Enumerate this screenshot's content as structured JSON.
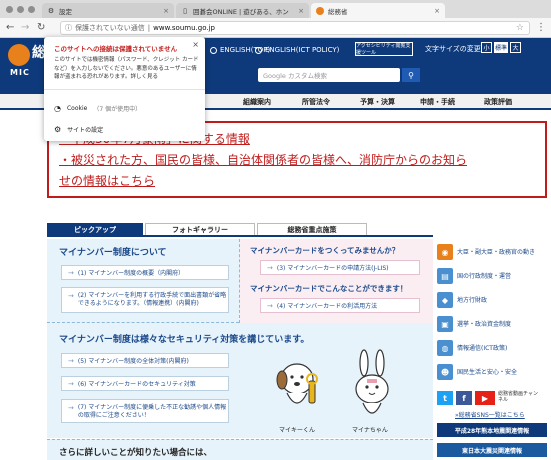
{
  "browser": {
    "tabs": [
      {
        "label": "設定",
        "icon": "gear-icon"
      },
      {
        "label": "囲碁会ONLINE | 遊びある、ホン",
        "icon": "document-icon"
      },
      {
        "label": "総務省",
        "icon": "soumu-favicon"
      }
    ],
    "security_label": "保護されていない通信",
    "url": "www.soumu.go.jp"
  },
  "popup": {
    "title": "このサイトへの接続は保護されていません",
    "body": "このサイトでは機密情報（パスワード、クレジット カードなど）を入力しないでください。悪意のあるユーザーに情報が盗まれる恐れがあります。詳しく見る",
    "cookie_label": "Cookie",
    "cookie_sub": "（7 個が使用中）",
    "settings_label": "サイトの設定"
  },
  "header": {
    "logo_text": "総",
    "logo_mic": "MIC",
    "english_top": "ENGLISH(TOP)",
    "english_ict": "ENGLISH(ICT POLICY)",
    "access_tool": "アクセシビリティ閲覧支援ツール",
    "fontsize_label": "文字サイズの変更",
    "fontsize_small": "小",
    "fontsize_standard": "標準",
    "fontsize_large": "大",
    "search_placeholder": "Google カスタム検索"
  },
  "gnav": [
    "組織案内",
    "所管法令",
    "予算・決算",
    "申請・手続",
    "政策評価"
  ],
  "alert": {
    "line1": "「平成30年7月豪雨」に関する情報",
    "line2": "・被災された方、国民の皆様、自治体関係者の皆様へ、消防庁からのお知ら",
    "line3": "せの情報はこちら"
  },
  "content_tabs": [
    "ピックアップ",
    "フォトギャラリー",
    "総務省重点施策"
  ],
  "mynumber": {
    "heading_about": "マイナンバー制度について",
    "links_blue": [
      "(1) マイナンバー制度の概要（内閣府）",
      "(2) マイナンバーを利用する行政手続で面出書類が省略できるようになります。（情報連携）(内閣府)"
    ],
    "card_question": "マイナンバーカードをつくってみませんか？",
    "link_card_apply": "(3) マイナンバーカードの申請方法(J-LIS)",
    "card_heading2": "マイナンバーカードでこんなことができます！",
    "link_card_usage": "(4) マイナンバーカードの利活用方法",
    "security_heading": "マイナンバー制度は様々なセキュリティ対策を講じています。",
    "security_links": [
      "(5) マイナンバー制度の全体対策(内閣府)",
      "(6) マイナンバーカードのセキュリティ対策",
      "(7) マイナンバー制度に便乗した不正な勧誘や個人情報の取得にご注意ください！"
    ],
    "mascot_left": "マイキーくん",
    "mascot_right": "マイナちゃん",
    "more_info": "さらに詳しいことが知りたい場合には、"
  },
  "sidebar": {
    "items": [
      {
        "label": "大臣・副大臣・政務官の動き",
        "icon": "camera-icon",
        "color": "#e8801b"
      },
      {
        "label": "国の行政制度・運営",
        "icon": "building-icon",
        "color": "#4a8fcf"
      },
      {
        "label": "地方行財政",
        "icon": "map-icon",
        "color": "#4a8fcf"
      },
      {
        "label": "選挙・政治資金制度",
        "icon": "ballot-icon",
        "color": "#4a8fcf"
      },
      {
        "label": "情報通信(ICT政策)",
        "icon": "globe-icon",
        "color": "#4a8fcf"
      },
      {
        "label": "国民生活と安心・安全",
        "icon": "people-icon",
        "color": "#4a8fcf"
      }
    ],
    "sns_link": "»総務省SNS一覧はこちら",
    "youtube_label": "総務省動画チャンネル",
    "banner1": "平成28年熊本地震関連情報",
    "banner2": "東日本大震災関連情報"
  }
}
